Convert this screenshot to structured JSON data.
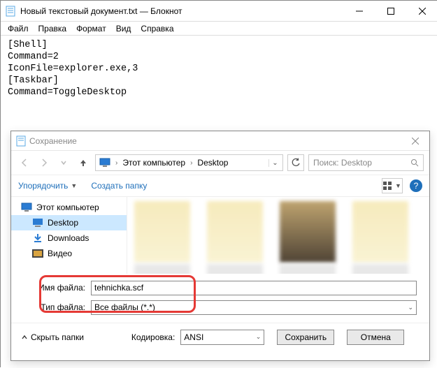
{
  "notepad": {
    "title": "Новый текстовый документ.txt — Блокнот",
    "menu": {
      "file": "Файл",
      "edit": "Правка",
      "format": "Формат",
      "view": "Вид",
      "help": "Справка"
    },
    "content": "[Shell]\nCommand=2\nIconFile=explorer.exe,3\n[Taskbar]\nCommand=ToggleDesktop"
  },
  "dialog": {
    "title": "Сохранение",
    "breadcrumb": {
      "root": "Этот компьютер",
      "folder": "Desktop"
    },
    "search_placeholder": "Поиск: Desktop",
    "toolbar": {
      "organize": "Упорядочить",
      "newfolder": "Создать папку"
    },
    "tree": {
      "pc": "Этот компьютер",
      "desktop": "Desktop",
      "downloads": "Downloads",
      "video": "Видео"
    },
    "form": {
      "filename_label": "Имя файла:",
      "filename_value": "tehnichka.scf",
      "filetype_label": "Тип файла:",
      "filetype_value": "Все файлы  (*.*)"
    },
    "footer": {
      "hide": "Скрыть папки",
      "encoding_label": "Кодировка:",
      "encoding_value": "ANSI",
      "save": "Сохранить",
      "cancel": "Отмена"
    }
  }
}
